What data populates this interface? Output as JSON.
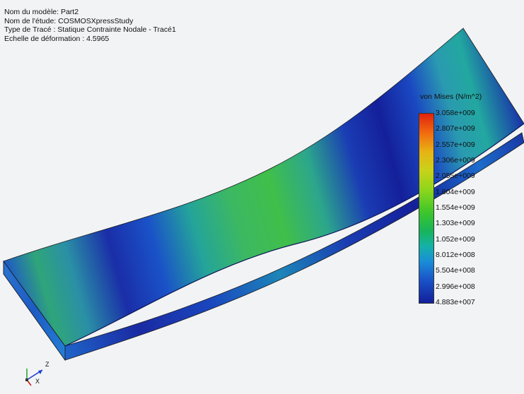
{
  "info": {
    "model": "Nom du modèle: Part2",
    "study": "Nom de l'étude: COSMOSXpressStudy",
    "plot_type": "Type de Tracé : Statique Contrainte Nodale - Tracé1",
    "deformation": "Echelle de déformation : 4.5965"
  },
  "legend": {
    "title": "von Mises (N/m^2)",
    "ticks": [
      "3.058e+009",
      "2.807e+009",
      "2.557e+009",
      "2.306e+009",
      "2.055e+009",
      "1.804e+009",
      "1.554e+009",
      "1.303e+009",
      "1.052e+009",
      "8.012e+008",
      "5.504e+008",
      "2.996e+008",
      "4.883e+007"
    ],
    "max_color": "#e0220c",
    "min_color": "#12209a"
  },
  "triad": {
    "z": "Z",
    "x": "X"
  },
  "colors": {
    "background": "#f2f3f5",
    "low_stress": "#12209a",
    "mid_stress": "#3ec62a",
    "outline": "#1a1a1a"
  }
}
